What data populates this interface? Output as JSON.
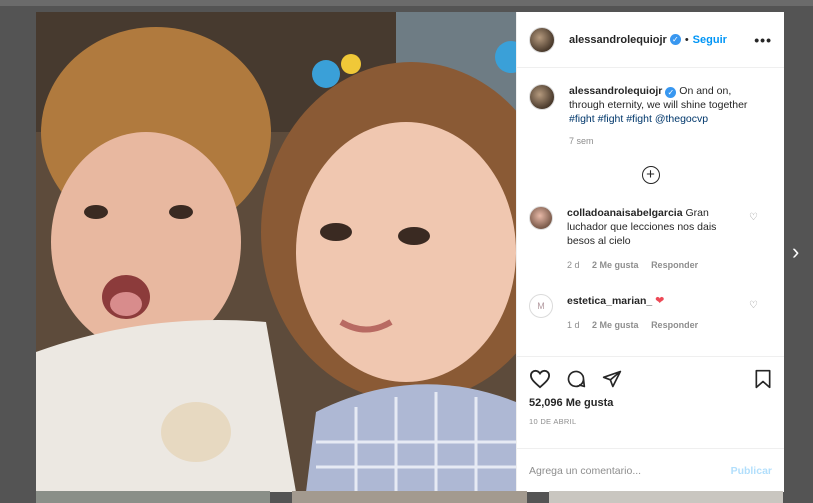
{
  "post": {
    "username": "alessandrolequiojr",
    "verified_mark": "✓",
    "dot": "•",
    "follow_label": "Seguir",
    "more_label": "•••",
    "caption_text": "On and on, through eternity, we will shine together",
    "hashtags": [
      "#fight",
      "#fight",
      "#fight"
    ],
    "mention": "@thegocvp",
    "caption_time": "7 sem",
    "load_more_label": "+",
    "likes": "52,096 Me gusta",
    "date": "10 DE ABRIL"
  },
  "comments": [
    {
      "username": "colladoanaisabelgarcia",
      "text": "Gran luchador que lecciones nos dais besos al cielo",
      "time": "2 d",
      "likes": "2 Me gusta",
      "reply_label": "Responder",
      "avatar_icon": "user-avatar"
    },
    {
      "username": "estetica_marian_",
      "text": "",
      "emoji": "❤",
      "time": "1 d",
      "likes": "2 Me gusta",
      "reply_label": "Responder",
      "avatar_icon": "logo-avatar",
      "avatar_letter": "M"
    }
  ],
  "comment_box": {
    "placeholder": "Agrega un comentario...",
    "publish_label": "Publicar"
  },
  "icons": {
    "like": "heart-icon",
    "comment": "comment-icon",
    "share": "share-icon",
    "save": "bookmark-icon",
    "next": "chevron-right-icon"
  },
  "colors": {
    "accent": "#0095f6",
    "verified": "#3897f0",
    "heart_red": "#ed4956",
    "publish_disabled": "#b2dffc",
    "backdrop": "#545454"
  },
  "nav": {
    "next_glyph": "›"
  }
}
